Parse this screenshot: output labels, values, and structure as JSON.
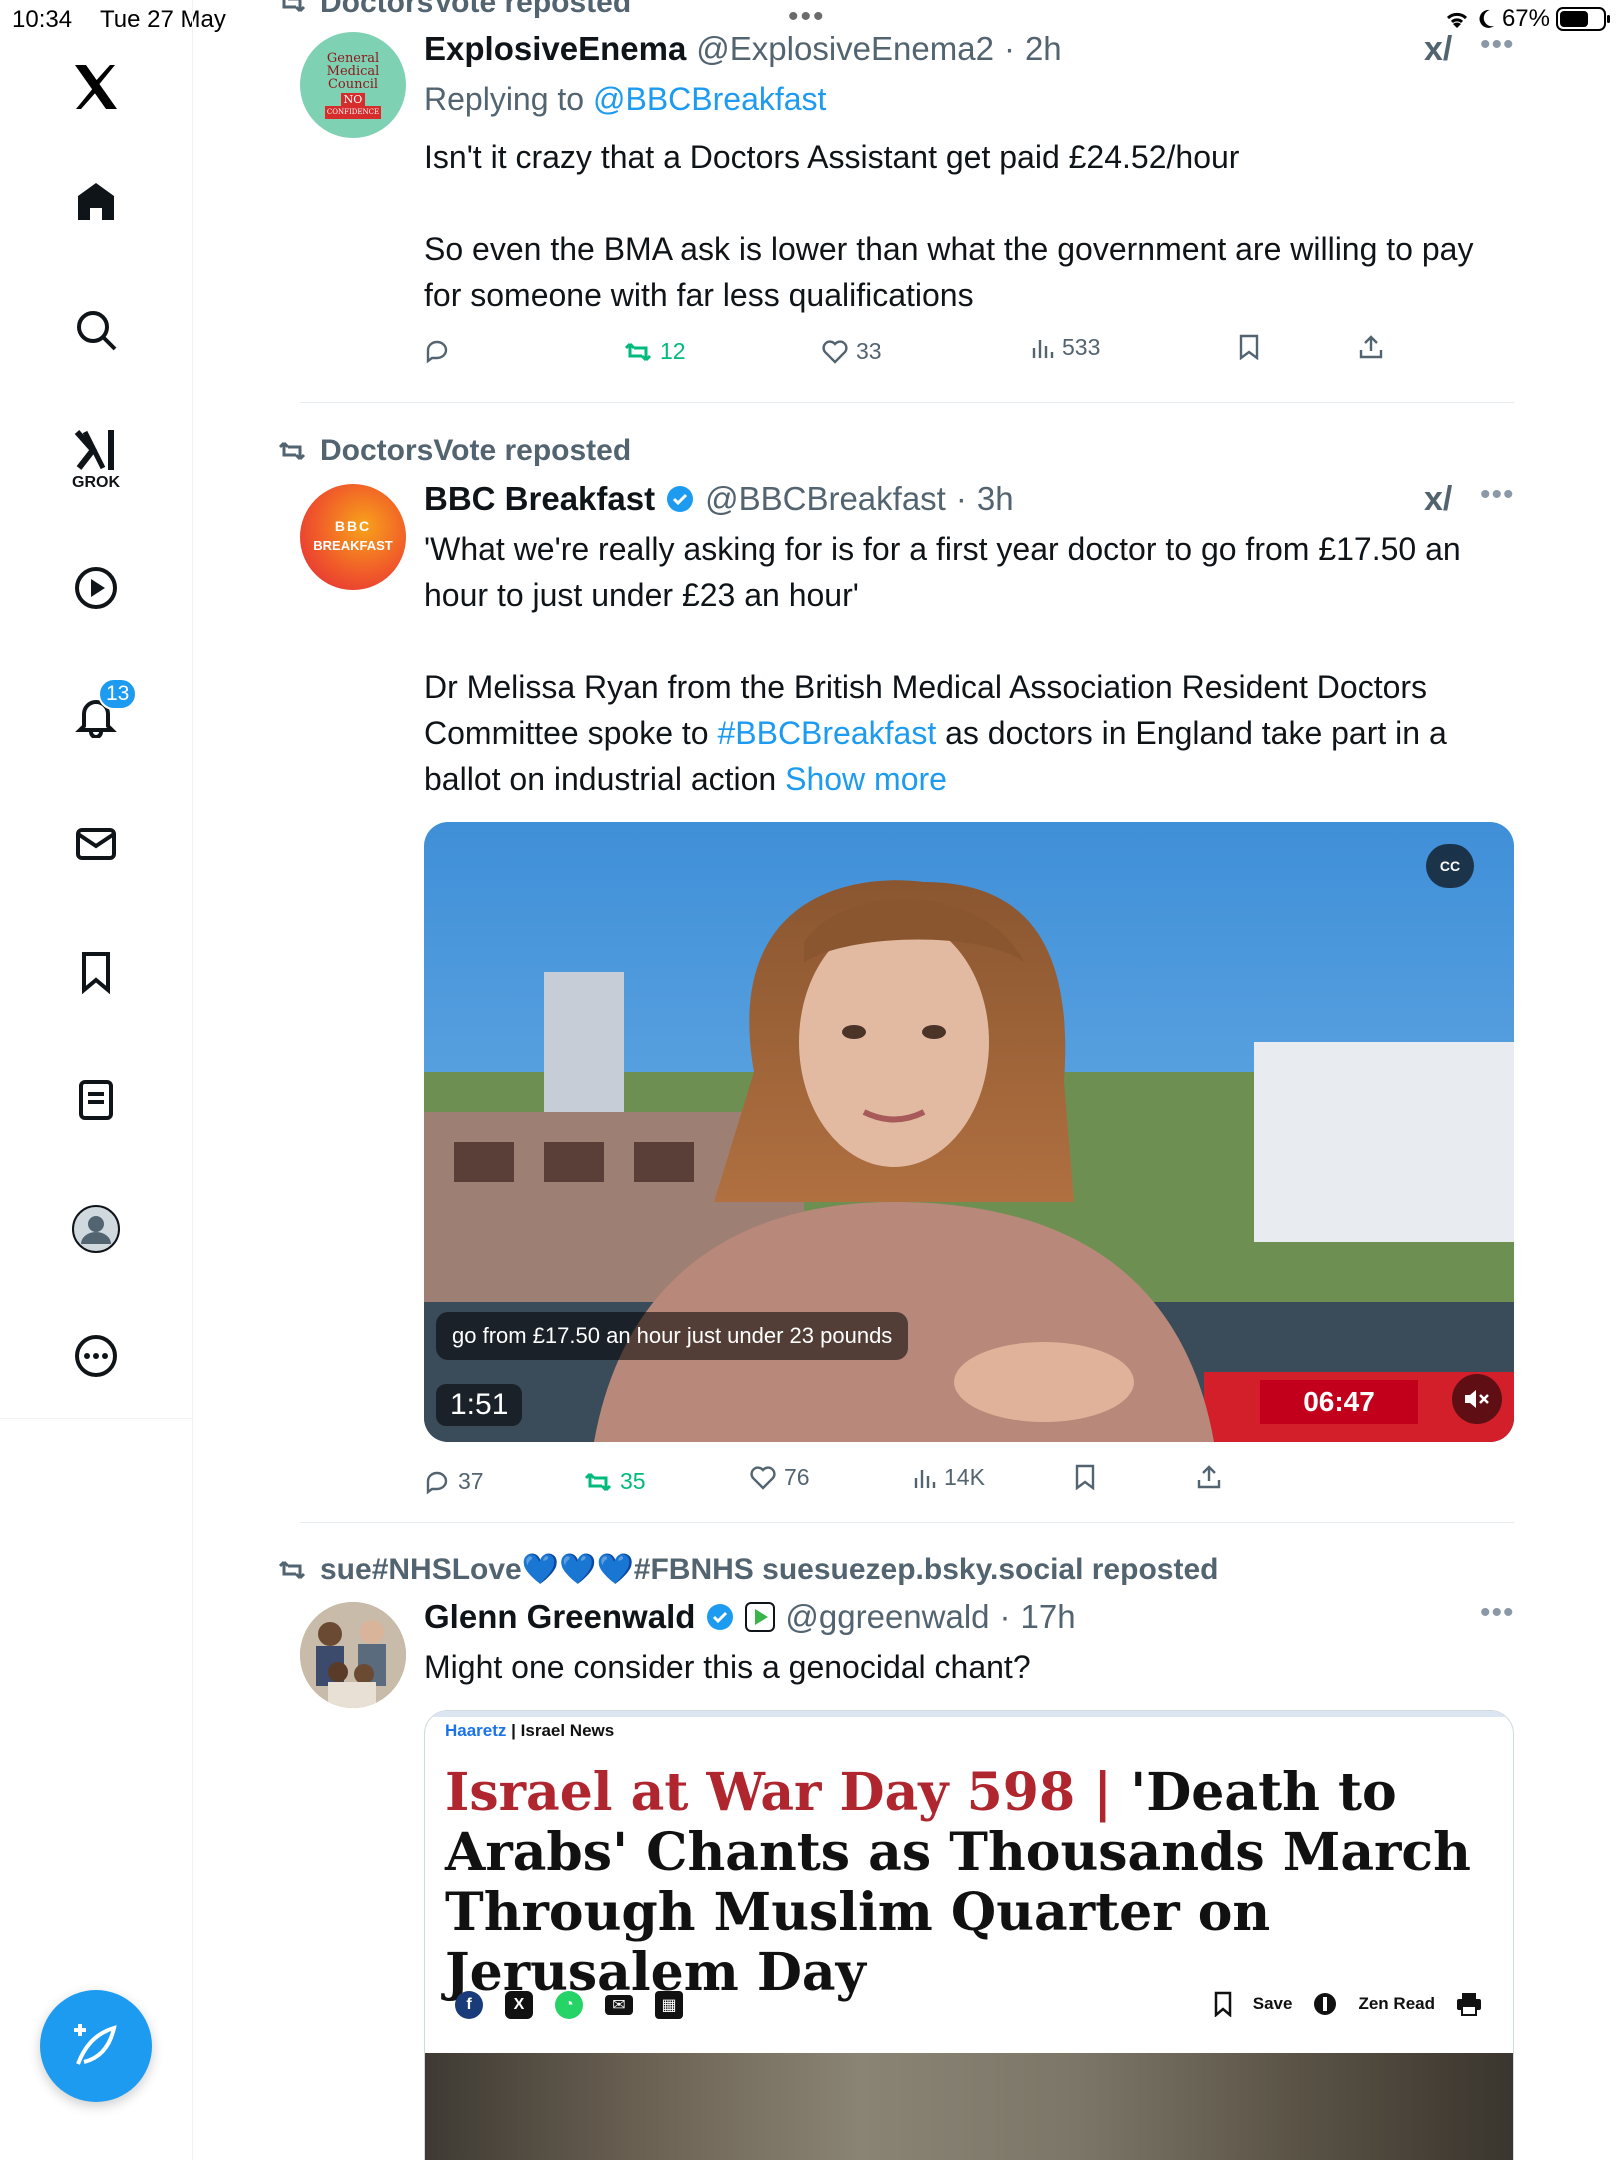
{
  "status_bar": {
    "time": "10:34",
    "date": "Tue 27 May",
    "battery": "67%"
  },
  "sidebar": {
    "logo": "x-logo-icon",
    "items": [
      {
        "icon": "home-icon"
      },
      {
        "icon": "search-icon"
      },
      {
        "icon": "grok-icon",
        "label": "GROK"
      },
      {
        "icon": "video-play-icon"
      },
      {
        "icon": "notifications-bell-icon",
        "badge": "13"
      },
      {
        "icon": "messages-envelope-icon"
      },
      {
        "icon": "bookmark-icon"
      },
      {
        "icon": "lists-icon"
      },
      {
        "icon": "profile-avatar-icon"
      },
      {
        "icon": "more-circle-icon"
      }
    ],
    "compose": "compose-post-icon"
  },
  "feed": {
    "top_repost_partial": "DoctorsVote reposted",
    "tweet1": {
      "name": "ExplosiveEnema",
      "handle": "@ExplosiveEnema2",
      "sep": "·",
      "time": "2h",
      "reply_prefix": "Replying to",
      "reply_to": "@BBCBreakfast",
      "avatar_lines": [
        "General",
        "Medical",
        "Council",
        "NO",
        "CONFIDENCE"
      ],
      "text1": "Isn't it crazy that a Doctors Assistant get paid £24.52/hour",
      "text2": "So even the BMA ask is lower than what the government are willing to pay for someone with far less qualifications",
      "stats": {
        "replies": "",
        "reposts": "12",
        "likes": "33",
        "views": "533"
      }
    },
    "tweet2": {
      "repost_by": "DoctorsVote reposted",
      "name": "BBC Breakfast",
      "handle": "@BBCBreakfast",
      "sep": "·",
      "time": "3h",
      "avatar_text": "BBC",
      "avatar_sub": "BREAKFAST",
      "text1": "'What we're really asking for is for a first year doctor to go from £17.50 an hour to just under £23 an hour'",
      "text2a": "Dr Melissa Ryan from the British Medical Association Resident Doctors Committee spoke to ",
      "hashtag": "#BBCBreakfast",
      "text2b": " as doctors in England take part in a ballot on industrial action ",
      "show_more": "Show more",
      "video": {
        "cc": "CC",
        "caption": "go from £17.50 an hour just under 23 pounds",
        "duration": "1:51",
        "clock": "06:47"
      },
      "stats": {
        "replies": "37",
        "reposts": "35",
        "likes": "76",
        "views": "14K"
      }
    },
    "tweet3": {
      "repost_by": "sue#NHSLove💙💙💙#FBNHS suesuezep.bsky.social reposted",
      "name": "Glenn Greenwald",
      "handle": "@ggreenwald",
      "sep": "·",
      "time": "17h",
      "text": "Might one consider this a genocidal chant?",
      "card": {
        "publication": "Haaretz",
        "section_sep": "|",
        "section": "Israel News",
        "headline_red": "Israel at War Day 598 | ",
        "headline_black": "'Death to Arabs' Chants as Thousands March Through Muslim Quarter on Jerusalem Day",
        "save": "Save",
        "zen": "Zen Read"
      }
    }
  },
  "colors": {
    "accent": "#1d9bf0",
    "repost_green": "#00ba7c",
    "muted": "#536471",
    "haaretz_red": "#b0262f",
    "bbc_red": "#c3001b"
  }
}
